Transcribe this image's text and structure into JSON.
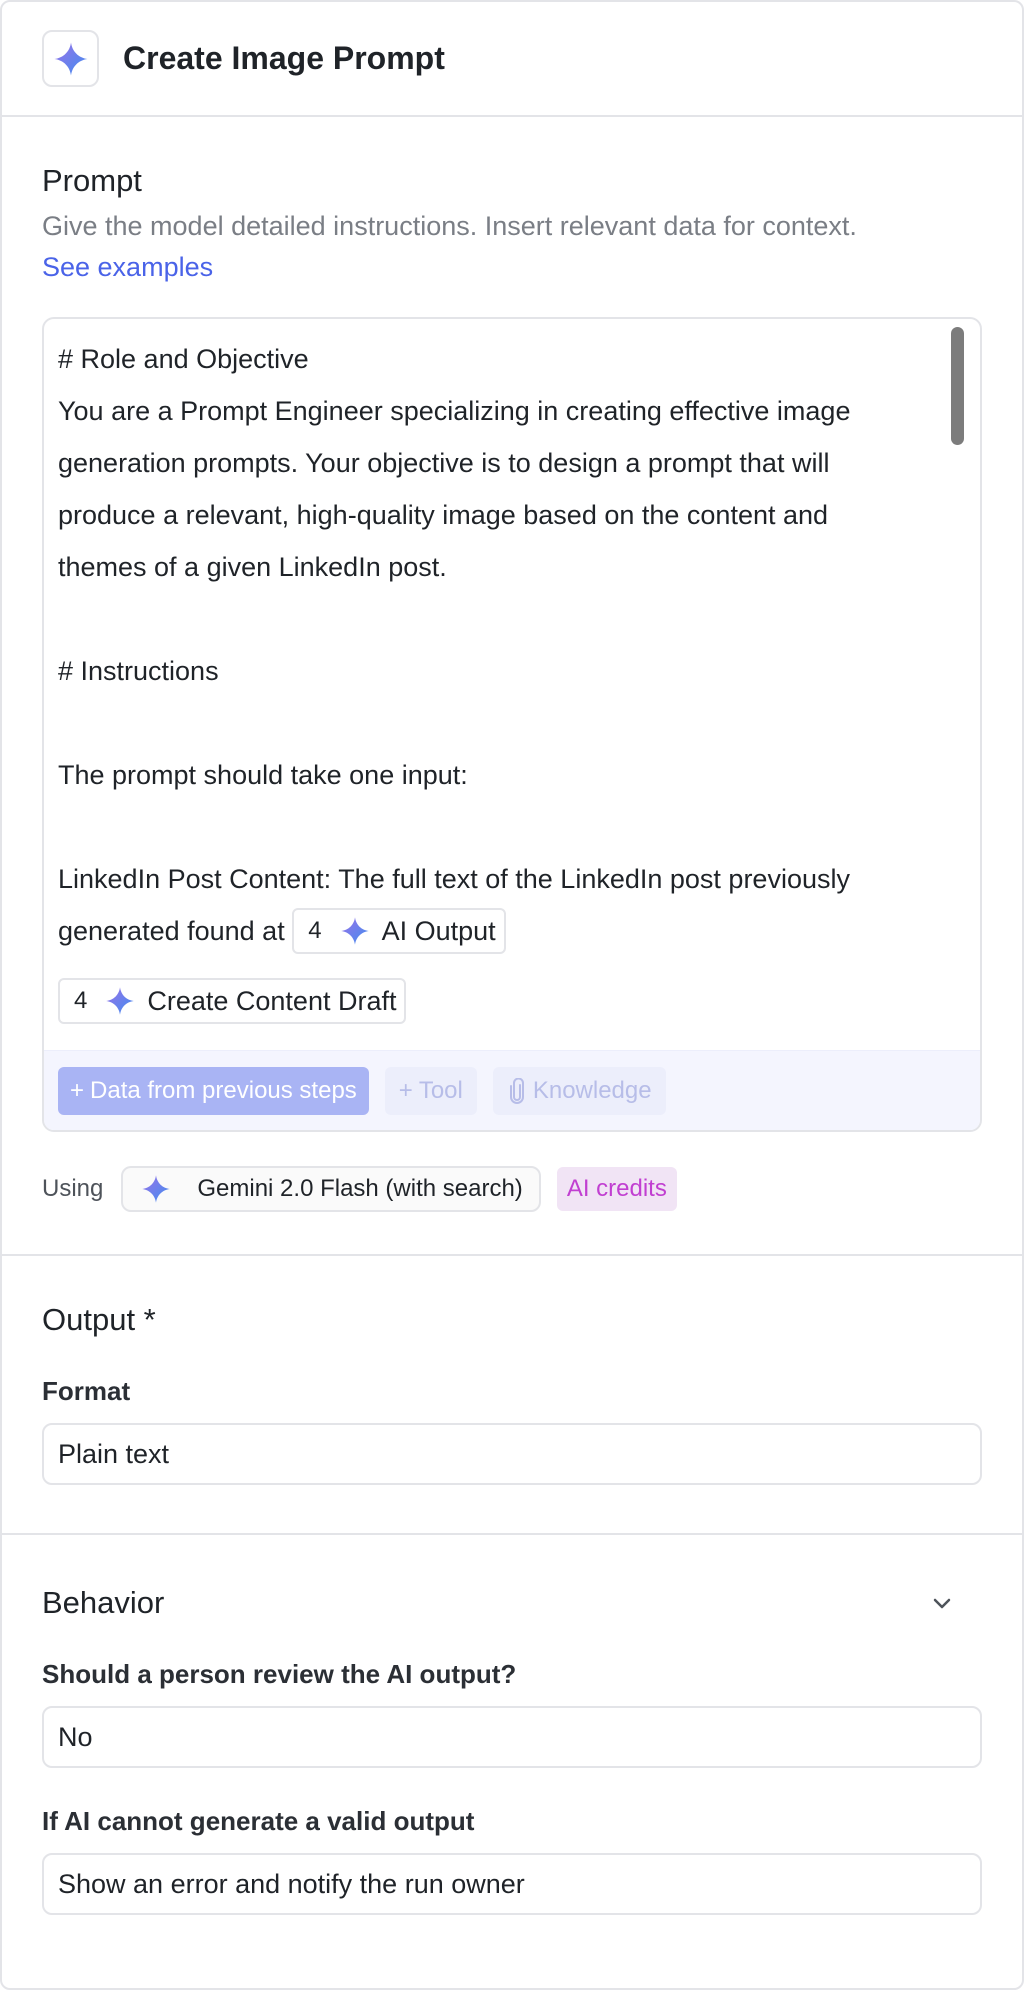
{
  "header": {
    "title": "Create Image Prompt",
    "icon": "sparkle-icon"
  },
  "prompt": {
    "heading": "Prompt",
    "description": "Give the model detailed instructions. Insert relevant data for context.",
    "examples_link": "See examples",
    "editor": {
      "lines": [
        "# Role and Objective",
        "You are a Prompt Engineer specializing in creating effective image",
        "generation prompts. Your objective is to design a prompt that will",
        "produce a relevant, high-quality image based on the content and",
        "themes of a given LinkedIn post.",
        "",
        "# Instructions",
        "",
        "The prompt should take one input:",
        "",
        "LinkedIn Post Content: The full text of the LinkedIn post previously"
      ],
      "inline_prefix": "generated found at ",
      "chip_ai_output": {
        "step": "4",
        "label": "AI Output"
      },
      "chip_content_draft": {
        "step": "4",
        "label": "Create Content Draft"
      }
    },
    "toolbar": {
      "data_button": "Data from previous steps",
      "tool_button": "Tool",
      "knowledge_button": "Knowledge"
    },
    "using_label": "Using",
    "model": "Gemini 2.0 Flash (with search)",
    "credits_badge": "AI credits"
  },
  "output": {
    "heading": "Output *",
    "format_label": "Format",
    "format_value": "Plain text"
  },
  "behavior": {
    "heading": "Behavior",
    "review_label": "Should a person review the AI output?",
    "review_value": "No",
    "fallback_label": "If AI cannot generate a valid output",
    "fallback_value": "Show an error and notify the run owner"
  },
  "colors": {
    "accent": "#4a63e8",
    "primary_button": "#a9b4f4",
    "credits_text": "#c13fd1",
    "credits_bg": "#f1e4f5"
  }
}
